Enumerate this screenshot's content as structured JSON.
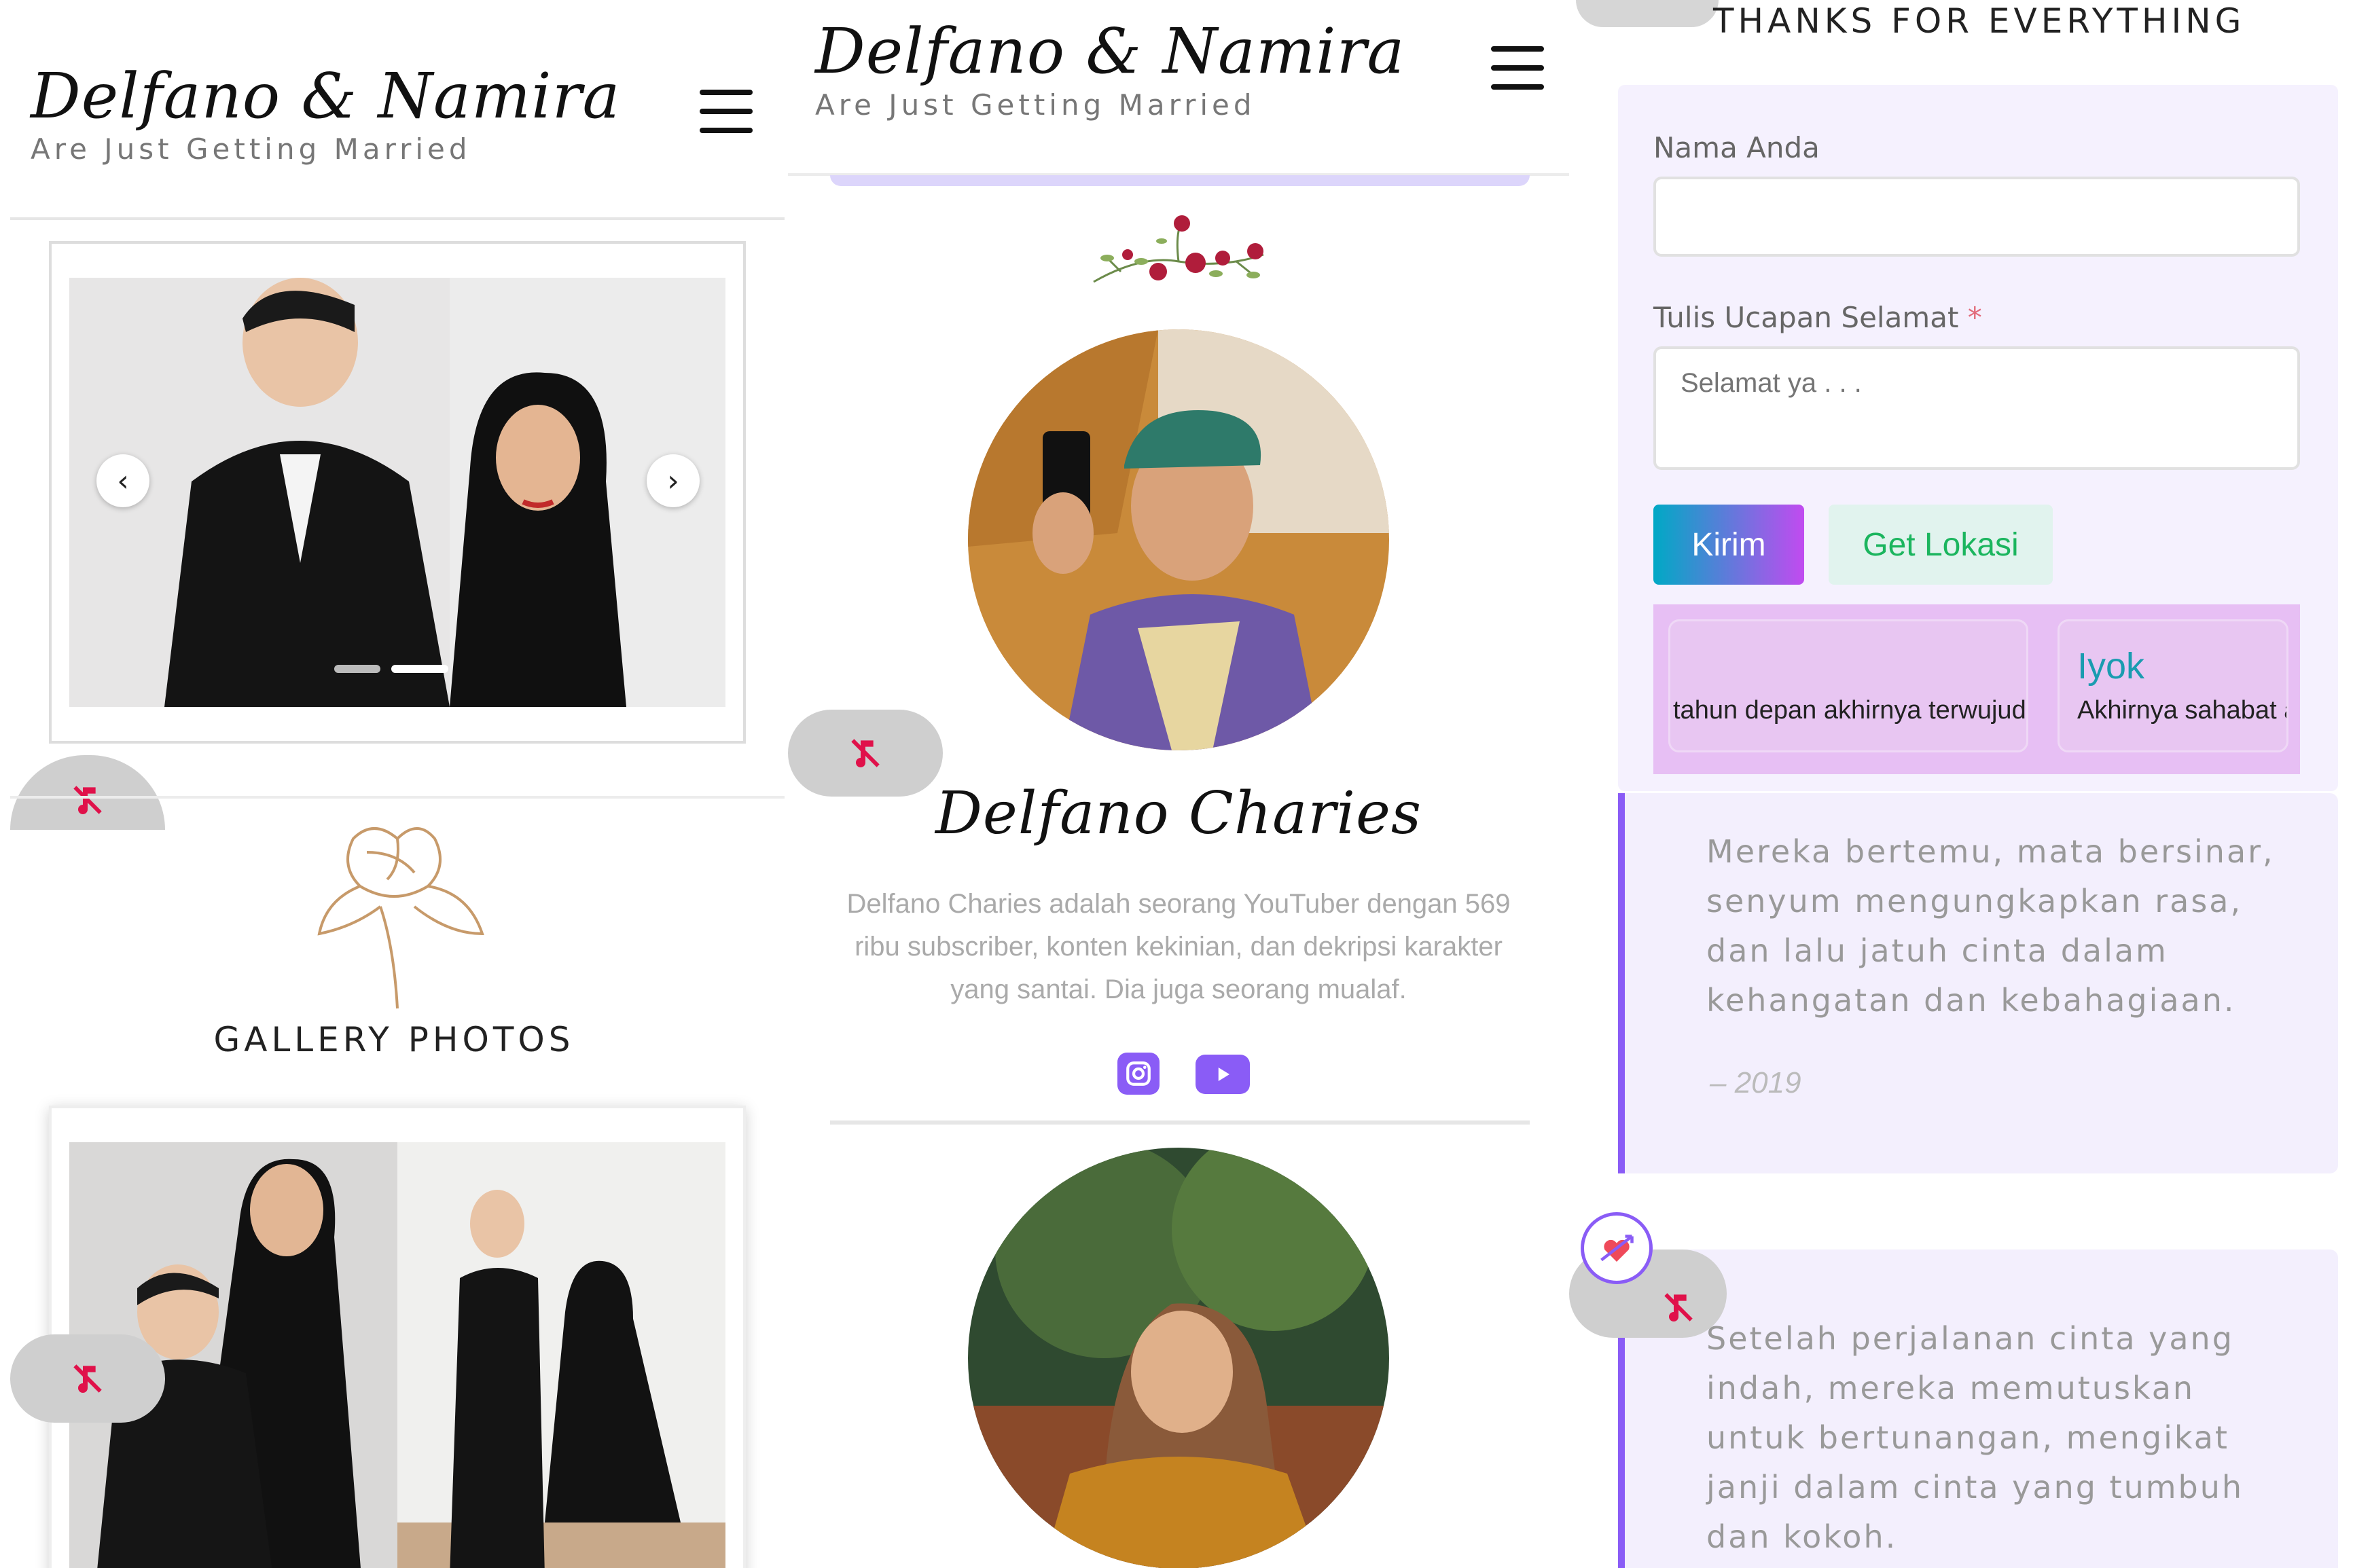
{
  "header": {
    "title": "Delfano & Namira",
    "tagline": "Are Just Getting Married"
  },
  "gallery": {
    "title": "GALLERY PHOTOS"
  },
  "profile": {
    "name": "Delfano Charies",
    "bio": "Delfano Charies adalah seorang YouTuber dengan 569 ribu subscriber, konten kekinian, dan dekripsi karakter yang santai. Dia juga seorang mualaf."
  },
  "guestbook": {
    "thanks": "THANKS FOR EVERYTHING",
    "name_label": "Nama Anda",
    "name_value": "",
    "message_label": "Tulis Ucapan Selamat",
    "required_mark": "*",
    "message_placeholder": "Selamat ya . . .",
    "submit_label": "Kirim",
    "location_label": "Get Lokasi",
    "wishes": [
      {
        "name": "",
        "message": "tahun depan akhirnya terwujud"
      },
      {
        "name": "Iyok",
        "message": "Akhirnya sahabat a"
      }
    ]
  },
  "story": [
    {
      "text": "Mereka bertemu, mata bersinar, senyum mengungkapkan rasa, dan lalu jatuh cinta dalam kehangatan dan kebahagiaan.",
      "year": "– 2019"
    },
    {
      "text": "Setelah perjalanan cinta yang indah, mereka memutuskan untuk bertunangan, mengikat janji dalam cinta yang tumbuh dan kokoh.",
      "year": ""
    }
  ],
  "colors": {
    "accent_purple": "#8a5cf6",
    "story_bg": "#f3effd",
    "form_bg": "#f5f1fe",
    "mute_icon": "#e0114a",
    "submit_gradient": [
      "#00a9c5",
      "#c14bf0"
    ],
    "location_bg": "#e1f3ee",
    "location_text": "#1bb55e"
  },
  "icons": [
    "hamburger-menu-icon",
    "music-muted-icon",
    "chevron-left-icon",
    "chevron-right-icon",
    "instagram-icon",
    "youtube-icon",
    "heart-arrow-icon",
    "rose-line-icon",
    "flower-garland-icon"
  ]
}
